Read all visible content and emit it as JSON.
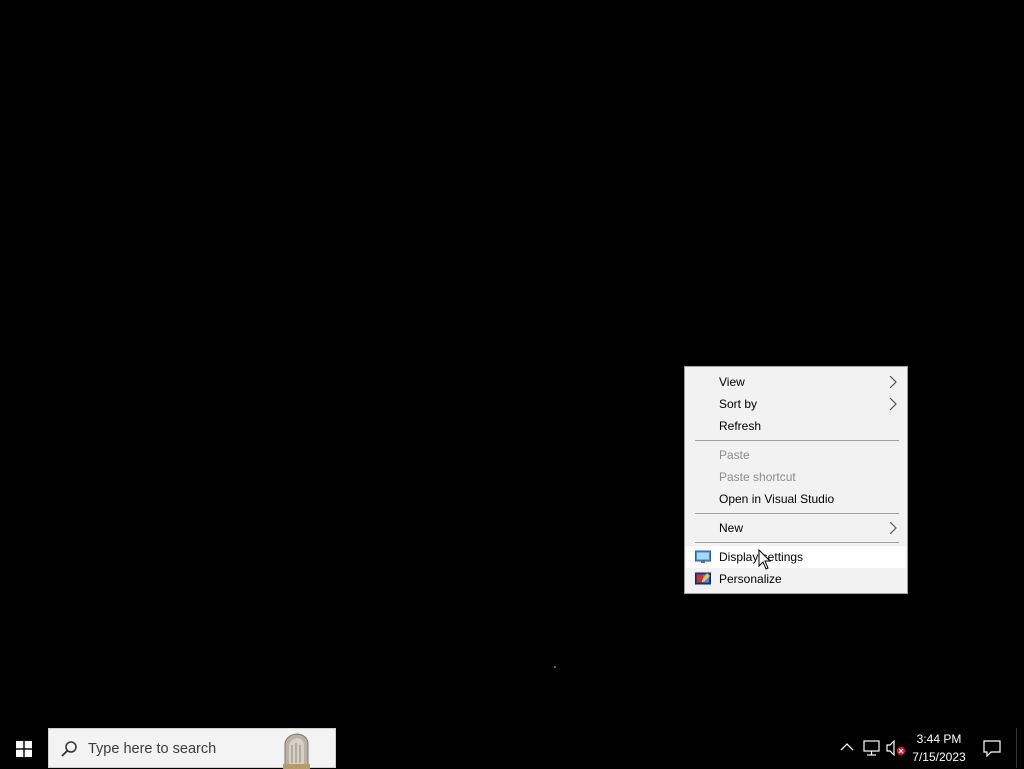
{
  "context_menu": {
    "items": [
      {
        "label": "View",
        "submenu": true,
        "enabled": true
      },
      {
        "label": "Sort by",
        "submenu": true,
        "enabled": true
      },
      {
        "label": "Refresh",
        "submenu": false,
        "enabled": true
      },
      {
        "label": "Paste",
        "submenu": false,
        "enabled": false
      },
      {
        "label": "Paste shortcut",
        "submenu": false,
        "enabled": false
      },
      {
        "label": "Open in Visual Studio",
        "submenu": false,
        "enabled": true
      },
      {
        "label": "New",
        "submenu": true,
        "enabled": true
      },
      {
        "label": "Display settings",
        "icon": "display-icon",
        "hovered": true,
        "enabled": true
      },
      {
        "label": "Personalize",
        "icon": "personalize-icon",
        "enabled": true
      }
    ]
  },
  "taskbar": {
    "search_placeholder": "Type here to search",
    "clock": {
      "time": "3:44 PM",
      "date": "7/15/2023"
    },
    "tray_icons": [
      "chevron-up-icon",
      "network-icon",
      "volume-muted-icon",
      "action-center-icon"
    ]
  },
  "colors": {
    "desktop_background": "#000000",
    "menu_background": "#f2f2f2",
    "menu_hover": "#ffffff",
    "disabled_text": "#8c8c8c"
  }
}
